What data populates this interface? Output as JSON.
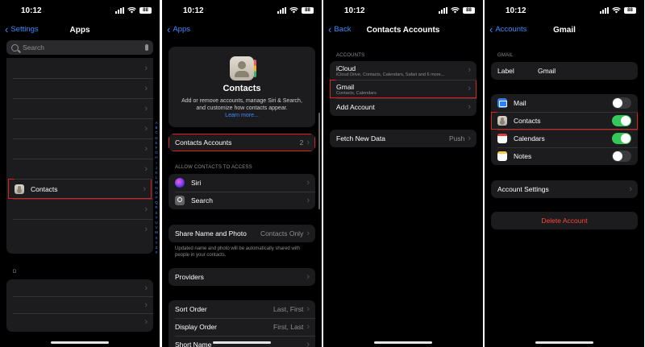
{
  "status": {
    "time": "10:12",
    "battery": "88"
  },
  "panel1": {
    "back_label": "Settings",
    "title": "Apps",
    "search_placeholder": "Search",
    "contacts_label": "Contacts",
    "section_d": "D"
  },
  "panel2": {
    "back_label": "Apps",
    "hero_title": "Contacts",
    "hero_desc": "Add or remove accounts, manage Siri & Search, and customize how contacts appear.",
    "learn_more": "Learn more...",
    "contacts_accounts_label": "Contacts Accounts",
    "contacts_accounts_value": "2",
    "allow_header": "ALLOW CONTACTS TO ACCESS",
    "siri_label": "Siri",
    "search_label": "Search",
    "share_label": "Share Name and Photo",
    "share_value": "Contacts Only",
    "share_note": "Updated name and photo will be automatically shared with people in your contacts.",
    "providers_label": "Providers",
    "sort_label": "Sort Order",
    "sort_value": "Last, First",
    "display_label": "Display Order",
    "display_value": "First, Last",
    "short_label": "Short Name",
    "index_letters": [
      "A",
      "B",
      "C",
      "D",
      "E",
      "F",
      "G",
      "H",
      "I",
      "J",
      "K",
      "L",
      "M",
      "N",
      "O",
      "P",
      "Q",
      "R",
      "S",
      "T",
      "U",
      "V",
      "W",
      "X",
      "Y",
      "Z",
      "#"
    ]
  },
  "panel3": {
    "back_label": "Back",
    "title": "Contacts Accounts",
    "accounts_header": "ACCOUNTS",
    "icloud_label": "iCloud",
    "icloud_sub": "iCloud Drive, Contacts, Calendars, Safari and 6 more...",
    "gmail_label": "Gmail",
    "gmail_sub": "Contacts, Calendars",
    "add_account_label": "Add Account",
    "fetch_label": "Fetch New Data",
    "fetch_value": "Push"
  },
  "panel4": {
    "back_label": "Accounts",
    "title": "Gmail",
    "gmail_header": "GMAIL",
    "label_key": "Label",
    "label_value": "Gmail",
    "mail_label": "Mail",
    "contacts_label": "Contacts",
    "calendars_label": "Calendars",
    "notes_label": "Notes",
    "account_settings_label": "Account Settings",
    "delete_label": "Delete Account",
    "toggles": {
      "mail": false,
      "contacts": true,
      "calendars": true,
      "notes": false
    }
  },
  "colors": {
    "accent": "#3b8cff",
    "highlight": "#e02020",
    "toggle_on": "#34c759",
    "destructive": "#ff453a"
  }
}
